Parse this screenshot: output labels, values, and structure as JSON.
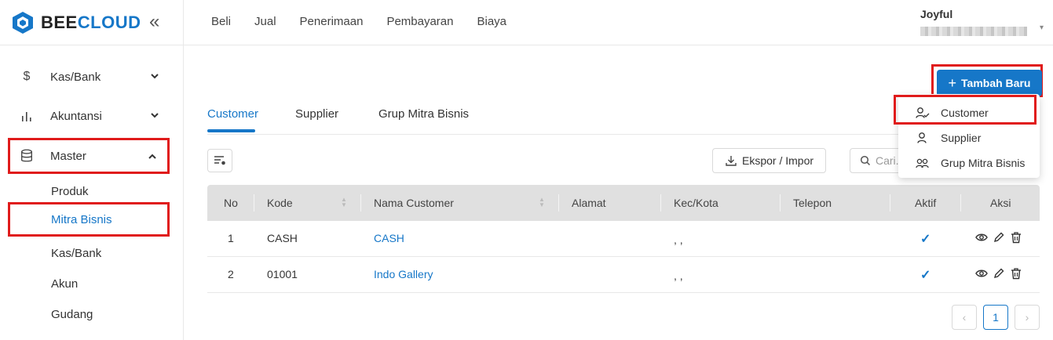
{
  "sidebar": {
    "logo": {
      "part1": "BEE",
      "part2": "CLOUD",
      "collapse_glyph": "«"
    },
    "items": [
      {
        "label": "Kas/Bank",
        "icon": "dollar-icon",
        "glyph": "$"
      },
      {
        "label": "Akuntansi",
        "icon": "bar-chart-icon",
        "glyph": "ılı"
      },
      {
        "label": "Master",
        "icon": "database-icon",
        "glyph": ""
      }
    ],
    "sub_items": [
      {
        "label": "Produk"
      },
      {
        "label": "Mitra Bisnis"
      },
      {
        "label": "Kas/Bank"
      },
      {
        "label": "Akun"
      },
      {
        "label": "Gudang"
      }
    ]
  },
  "topbar": {
    "menu": [
      "Beli",
      "Jual",
      "Penerimaan",
      "Pembayaran",
      "Biaya"
    ],
    "user_name": "Joyful"
  },
  "main": {
    "add_button": {
      "plus": "+",
      "label": "Tambah Baru"
    },
    "tabs": [
      "Customer",
      "Supplier",
      "Grup Mitra Bisnis"
    ],
    "export_label": "Ekspor / Impor",
    "search_placeholder": "Cari...",
    "table": {
      "headers": [
        "No",
        "Kode",
        "Nama Customer",
        "Alamat",
        "Kec/Kota",
        "Telepon",
        "Aktif",
        "Aksi"
      ],
      "rows": [
        {
          "no": "1",
          "kode": "CASH",
          "nama": "CASH",
          "alamat": "",
          "kota": ", ,",
          "telepon": "",
          "aktif": "✓"
        },
        {
          "no": "2",
          "kode": "01001",
          "nama": "Indo Gallery",
          "alamat": "",
          "kota": ", ,",
          "telepon": "",
          "aktif": "✓"
        }
      ]
    },
    "pagination": {
      "prev": "‹",
      "page": "1",
      "next": "›"
    }
  },
  "dropdown": {
    "items": [
      {
        "label": "Customer",
        "icon": "user-check-icon"
      },
      {
        "label": "Supplier",
        "icon": "user-icon"
      },
      {
        "label": "Grup Mitra Bisnis",
        "icon": "users-icon"
      }
    ]
  },
  "colors": {
    "accent": "#1677c8",
    "highlight": "#e01b1b",
    "header_bg": "#e0e0e0"
  }
}
